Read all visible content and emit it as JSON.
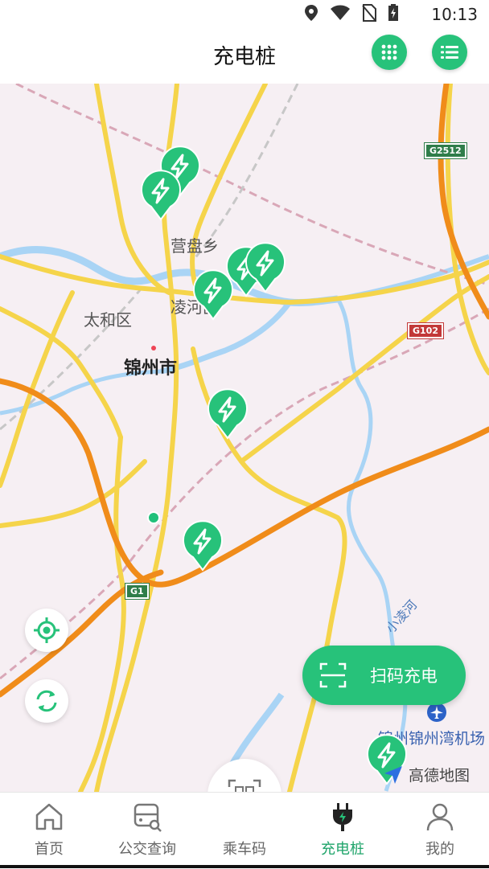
{
  "status_bar": {
    "time": "10:13",
    "icons": [
      "location-icon",
      "wifi-icon",
      "no-sim-icon",
      "battery-charging-icon"
    ]
  },
  "header": {
    "title": "充电桩",
    "grid_button_icon": "grid-icon",
    "list_button_icon": "list-icon"
  },
  "map": {
    "place_labels": [
      "营盘乡",
      "凌河区",
      "太和区",
      "锦州市"
    ],
    "road_badges": [
      "G2512",
      "G102",
      "G1"
    ],
    "river_label": "小凌河",
    "airport_label": "锦州锦州湾机场",
    "map_logo": "高德地图",
    "station_marker_count": 8,
    "colors": {
      "accent": "#27c27a",
      "highway": "#f08c1a",
      "road": "#f5d44a",
      "river": "#a9d4f5",
      "rail": "#d9a7b7"
    }
  },
  "actions": {
    "locate_icon": "locate-icon",
    "refresh_icon": "refresh-icon",
    "scan_charge_label": "扫码充电"
  },
  "tabs": [
    {
      "label": "首页",
      "icon": "home-icon"
    },
    {
      "label": "公交查询",
      "icon": "bus-icon"
    },
    {
      "label": "乘车码",
      "icon": "qr-code-icon"
    },
    {
      "label": "充电桩",
      "icon": "plug-icon",
      "active": true
    },
    {
      "label": "我的",
      "icon": "user-icon"
    }
  ]
}
